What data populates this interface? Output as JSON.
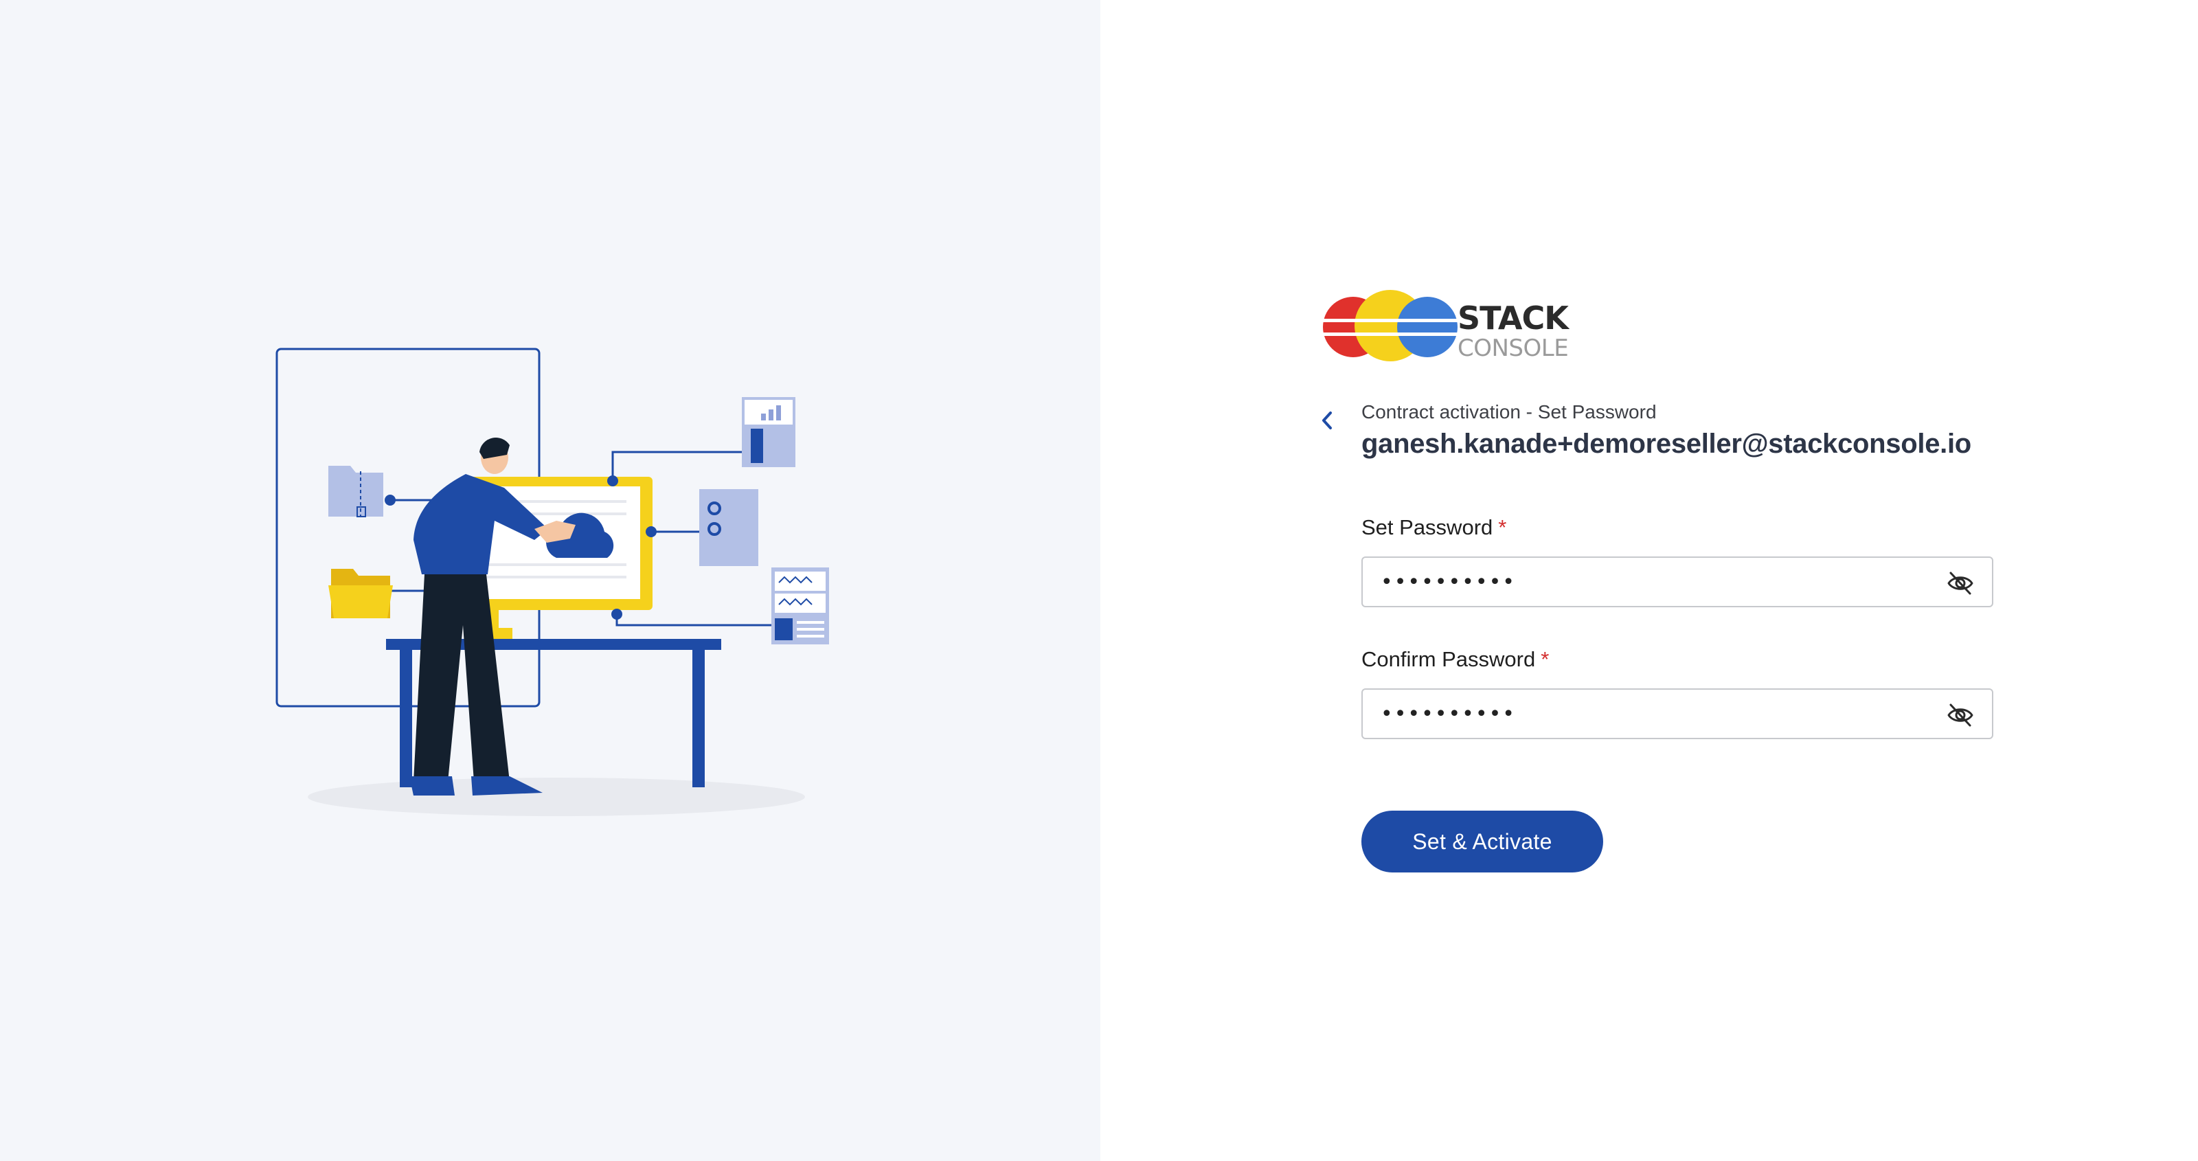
{
  "brand": {
    "name_line1": "STACK",
    "name_line2": "CONSOLE",
    "colors": [
      "#e0312c",
      "#f5d11c",
      "#3d7cd6"
    ]
  },
  "header": {
    "back_icon": "chevron-left-icon",
    "subtitle": "Contract activation - Set Password",
    "email": "ganesh.kanade+demoreseller@stackconsole.io"
  },
  "form": {
    "set_password": {
      "label": "Set Password",
      "required_marker": "*",
      "value": "••••••••••",
      "toggle_icon": "eye-off-icon"
    },
    "confirm_password": {
      "label": "Confirm Password",
      "required_marker": "*",
      "value": "••••••••••",
      "toggle_icon": "eye-off-icon"
    },
    "submit_label": "Set & Activate"
  },
  "theme": {
    "accent": "#1e4ba6",
    "required": "#d32f2f",
    "left_background": "#f4f6fa"
  }
}
